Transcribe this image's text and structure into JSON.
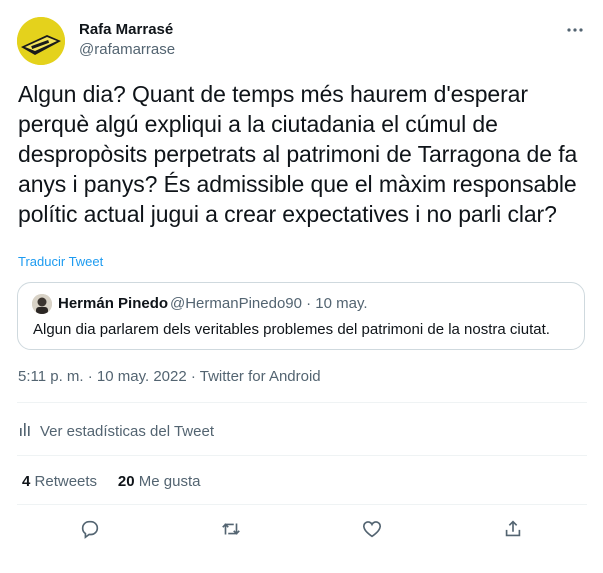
{
  "author": {
    "name": "Rafa Marrasé",
    "handle": "@rafamarrase"
  },
  "tweet": {
    "text": "Algun dia? Quant de temps més haurem d'esperar perquè algú expliqui a la ciutadania el cúmul de despropòsits perpetrats al patrimoni de Tarragona de fa anys i panys? És admissible que el màxim responsable polític actual jugui a crear expectatives i no parli clar?",
    "translate_label": "Traducir Tweet",
    "meta": "5:11 p. m. · 10 may. 2022 · Twitter for Android"
  },
  "quote": {
    "name": "Hermán Pinedo",
    "handle_date": "@HermanPinedo90 · 10 may.",
    "text": "Algun dia parlarem dels veritables problemes del patrimoni de la nostra ciutat."
  },
  "stats_label": "Ver estadísticas del Tweet",
  "counts": {
    "retweets_num": "4",
    "retweets_label": "Retweets",
    "likes_num": "20",
    "likes_label": "Me gusta"
  },
  "icons": [
    "more-icon",
    "stats-icon",
    "reply-icon",
    "retweet-icon",
    "like-icon",
    "share-icon"
  ],
  "colors": {
    "link": "#1d9bf0",
    "secondary": "#536471",
    "border": "#cfd9de"
  }
}
